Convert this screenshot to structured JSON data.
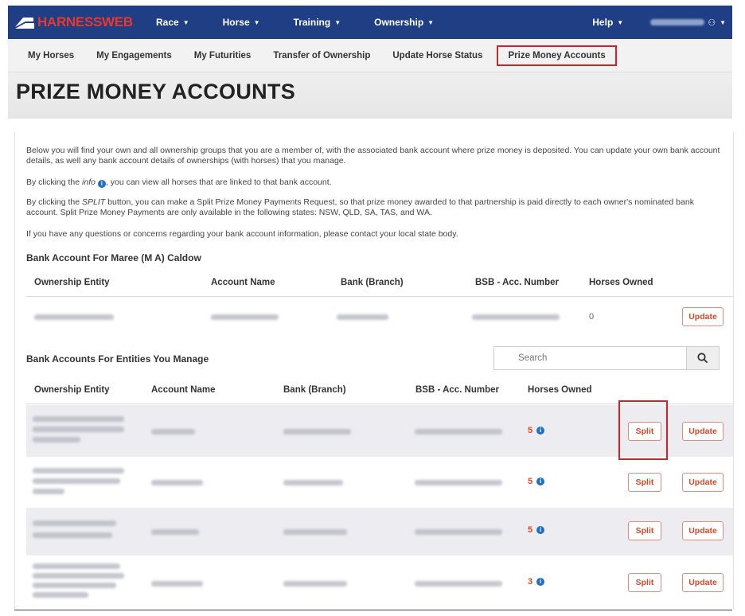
{
  "topnav": {
    "logo_text": "HARNESSWEB",
    "items": [
      {
        "label": "Race"
      },
      {
        "label": "Horse"
      },
      {
        "label": "Training"
      },
      {
        "label": "Ownership"
      },
      {
        "label": "Help"
      }
    ]
  },
  "subnav": {
    "items": [
      {
        "label": "My Horses"
      },
      {
        "label": "My Engagements"
      },
      {
        "label": "My Futurities"
      },
      {
        "label": "Transfer of Ownership"
      },
      {
        "label": "Update Horse Status"
      },
      {
        "label": "Prize Money Accounts",
        "active": true
      }
    ]
  },
  "page": {
    "title": "PRIZE MONEY ACCOUNTS",
    "intro": "Below you will find your own and all ownership groups that you are a member of, with the associated bank account where prize money is deposited. You can update your own bank account details, as well any bank account details of ownerships (with horses) that you manage.",
    "info_pre": "By clicking the ",
    "info_word": "info",
    "info_post": ", you can view all horses that are linked to that bank account.",
    "split_pre": "By clicking the ",
    "split_word": "SPLIT",
    "split_post": " button, you can make a Split Prize Money Payments Request, so that prize money awarded to that partnership is paid directly to each owner's nominated bank account. Split Prize Money Payments are only available in the following states: NSW, QLD, SA, TAS, and WA.",
    "questions": "If you have any questions or concerns regarding your bank account information, please contact your local state body."
  },
  "own_account": {
    "heading": "Bank Account For Maree (M A) Caldow",
    "columns": [
      "Ownership Entity",
      "Account Name",
      "Bank (Branch)",
      "BSB - Acc. Number",
      "Horses Owned"
    ],
    "row": {
      "horses": "0",
      "update_label": "Update"
    }
  },
  "managed": {
    "heading": "Bank Accounts For Entities You Manage",
    "search_placeholder": "Search",
    "columns": [
      "Ownership Entity",
      "Account Name",
      "Bank (Branch)",
      "BSB - Acc. Number",
      "Horses Owned"
    ],
    "rows": [
      {
        "horses": "5",
        "split_label": "Split",
        "update_label": "Update"
      },
      {
        "horses": "5",
        "split_label": "Split",
        "update_label": "Update"
      },
      {
        "horses": "5",
        "split_label": "Split",
        "update_label": "Update"
      },
      {
        "horses": "3",
        "split_label": "Split",
        "update_label": "Update"
      }
    ]
  },
  "colors": {
    "nav_blue": "#1f3e83",
    "accent_red": "#d42027",
    "button_text": "#d9472b",
    "info_blue": "#1f6fc5"
  }
}
